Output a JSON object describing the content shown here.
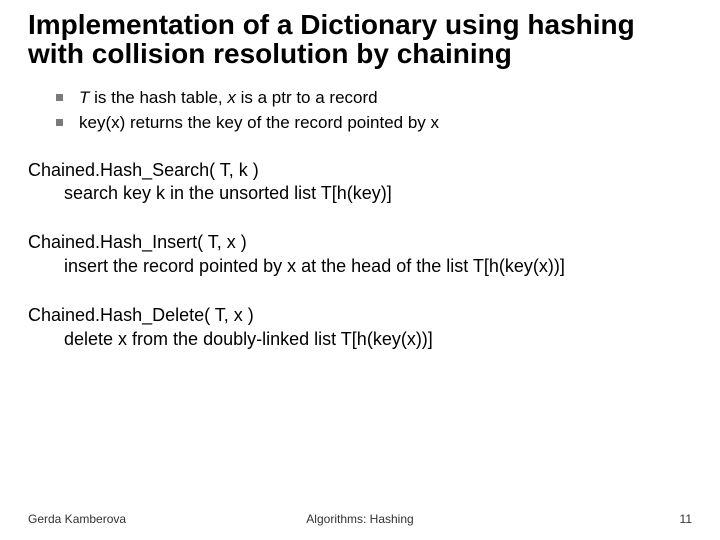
{
  "title": "Implementation of a Dictionary using hashing with collision resolution by chaining",
  "bullets": {
    "b1_pre": "",
    "b1_T": "T",
    "b1_mid1": " is the hash table, ",
    "b1_x": "x",
    "b1_post": " is a ptr to a record",
    "b2": "key(x) returns the key of the record pointed by x"
  },
  "blocks": {
    "search_fn": "Chained.Hash_Search( T, k )",
    "search_desc": "search key k in the unsorted list T[h(key)]",
    "insert_fn": "Chained.Hash_Insert( T,  x )",
    "insert_desc": "insert the record pointed by  x at the head of the list T[h(key(x))]",
    "delete_fn": "Chained.Hash_Delete( T, x )",
    "delete_desc": "delete x from the doubly-linked list T[h(key(x))]"
  },
  "footer": {
    "left": "Gerda Kamberova",
    "center": "Algorithms: Hashing",
    "right": "11"
  }
}
